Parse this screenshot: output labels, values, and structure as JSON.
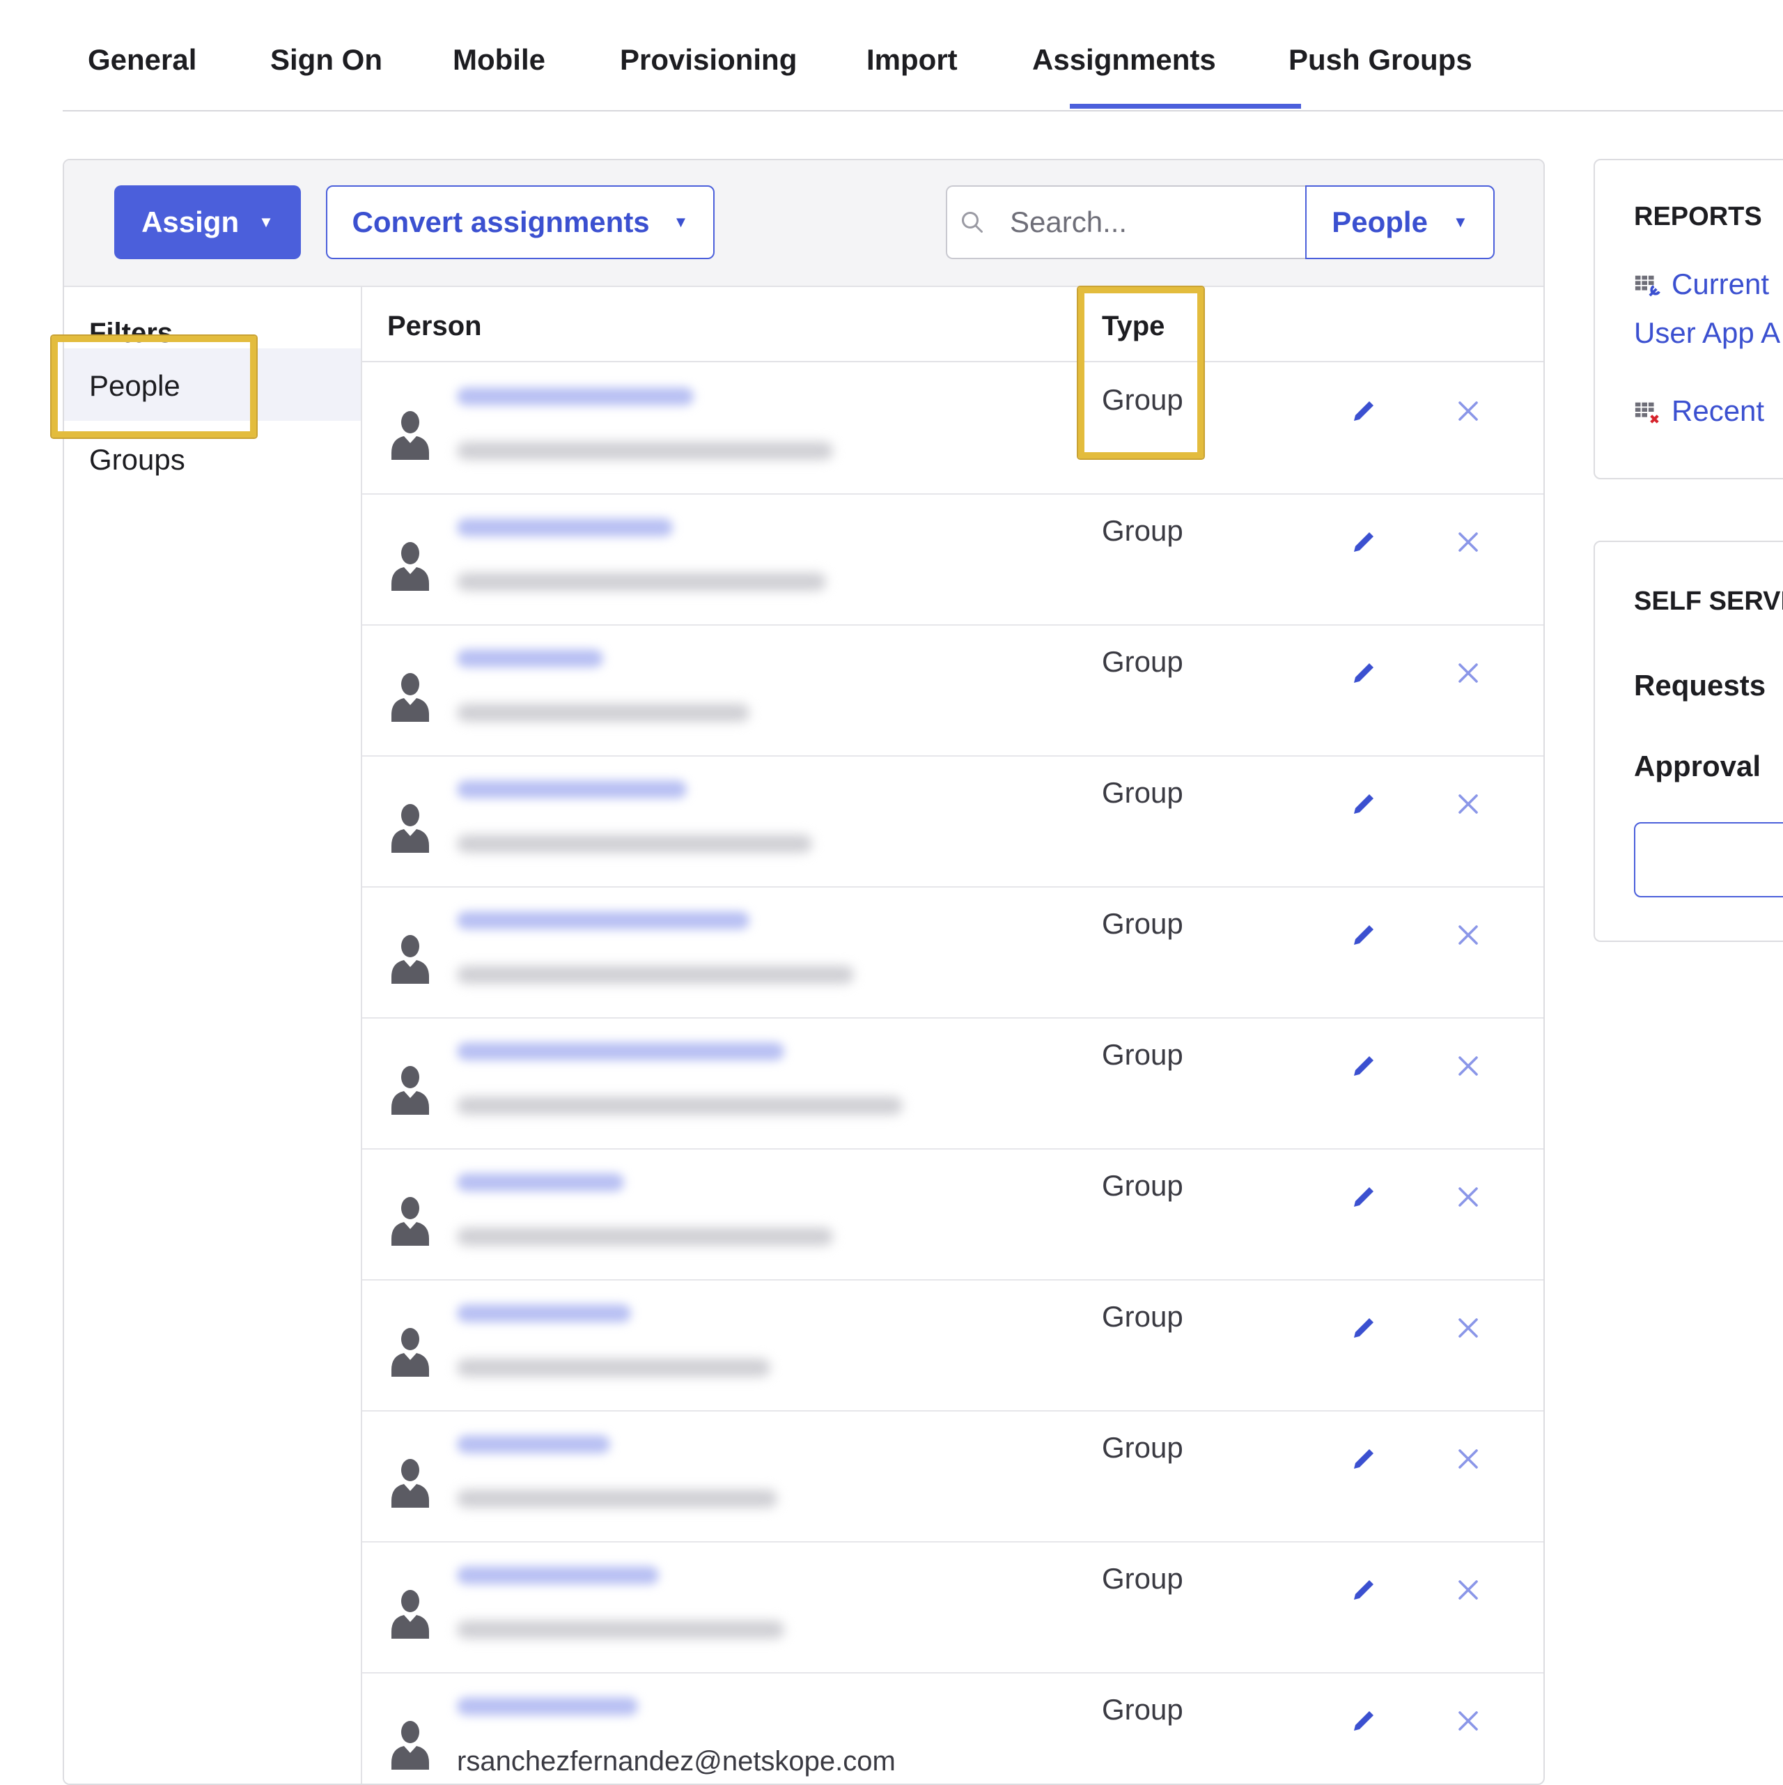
{
  "tabs": [
    {
      "label": "General"
    },
    {
      "label": "Sign On"
    },
    {
      "label": "Mobile"
    },
    {
      "label": "Provisioning"
    },
    {
      "label": "Import"
    },
    {
      "label": "Assignments",
      "active": true
    },
    {
      "label": "Push Groups"
    }
  ],
  "toolbar": {
    "assign_label": "Assign",
    "convert_label": "Convert assignments",
    "search_placeholder": "Search...",
    "people_dropdown_label": "People"
  },
  "filters": {
    "title": "Filters",
    "items": [
      {
        "label": "People",
        "selected": true
      },
      {
        "label": "Groups",
        "selected": false
      }
    ]
  },
  "table": {
    "headers": {
      "person": "Person",
      "type": "Type"
    },
    "rows": [
      {
        "type": "Group"
      },
      {
        "type": "Group"
      },
      {
        "type": "Group"
      },
      {
        "type": "Group"
      },
      {
        "type": "Group"
      },
      {
        "type": "Group"
      },
      {
        "type": "Group"
      },
      {
        "type": "Group"
      },
      {
        "type": "Group"
      },
      {
        "type": "Group"
      },
      {
        "type": "Group",
        "email": "rsanchezfernandez@netskope.com"
      }
    ]
  },
  "reports": {
    "title": "REPORTS",
    "link1_line1": "Current",
    "link1_line2": "User App A",
    "link2": "Recent"
  },
  "self_service": {
    "title": "SELF SERVI",
    "requests_label": "Requests",
    "approval_label": "Approval"
  },
  "colors": {
    "accent": "#4b5fdb",
    "highlight": "#e3bc3d",
    "avatar": "#5b5b63",
    "remove": "#8a96e8"
  },
  "icons": {
    "search": "search-icon",
    "avatar": "person-silhouette-icon",
    "edit": "pencil-icon",
    "remove": "close-icon",
    "report_current": "table-wrench-icon",
    "report_recent": "table-x-icon"
  }
}
